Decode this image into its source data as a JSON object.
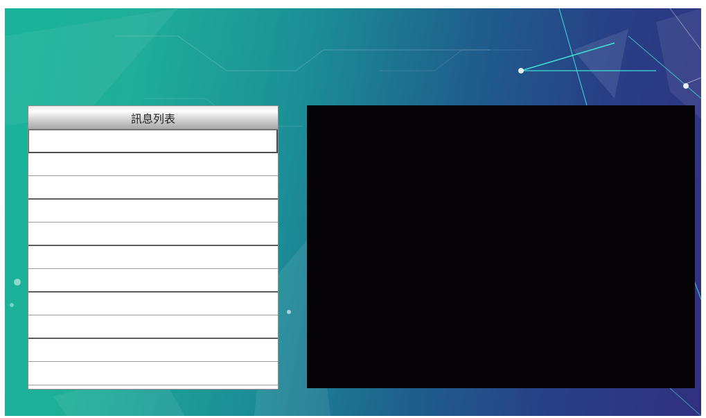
{
  "message_panel": {
    "title": "訊息列表",
    "rows": [
      "",
      "",
      "",
      "",
      "",
      "",
      "",
      "",
      "",
      "",
      ""
    ]
  },
  "video_display": {
    "state": "blank"
  },
  "colors": {
    "background_left": "#19b39a",
    "background_right": "#31307f",
    "display": "#050305",
    "accent_line": "#3fe0d6"
  }
}
